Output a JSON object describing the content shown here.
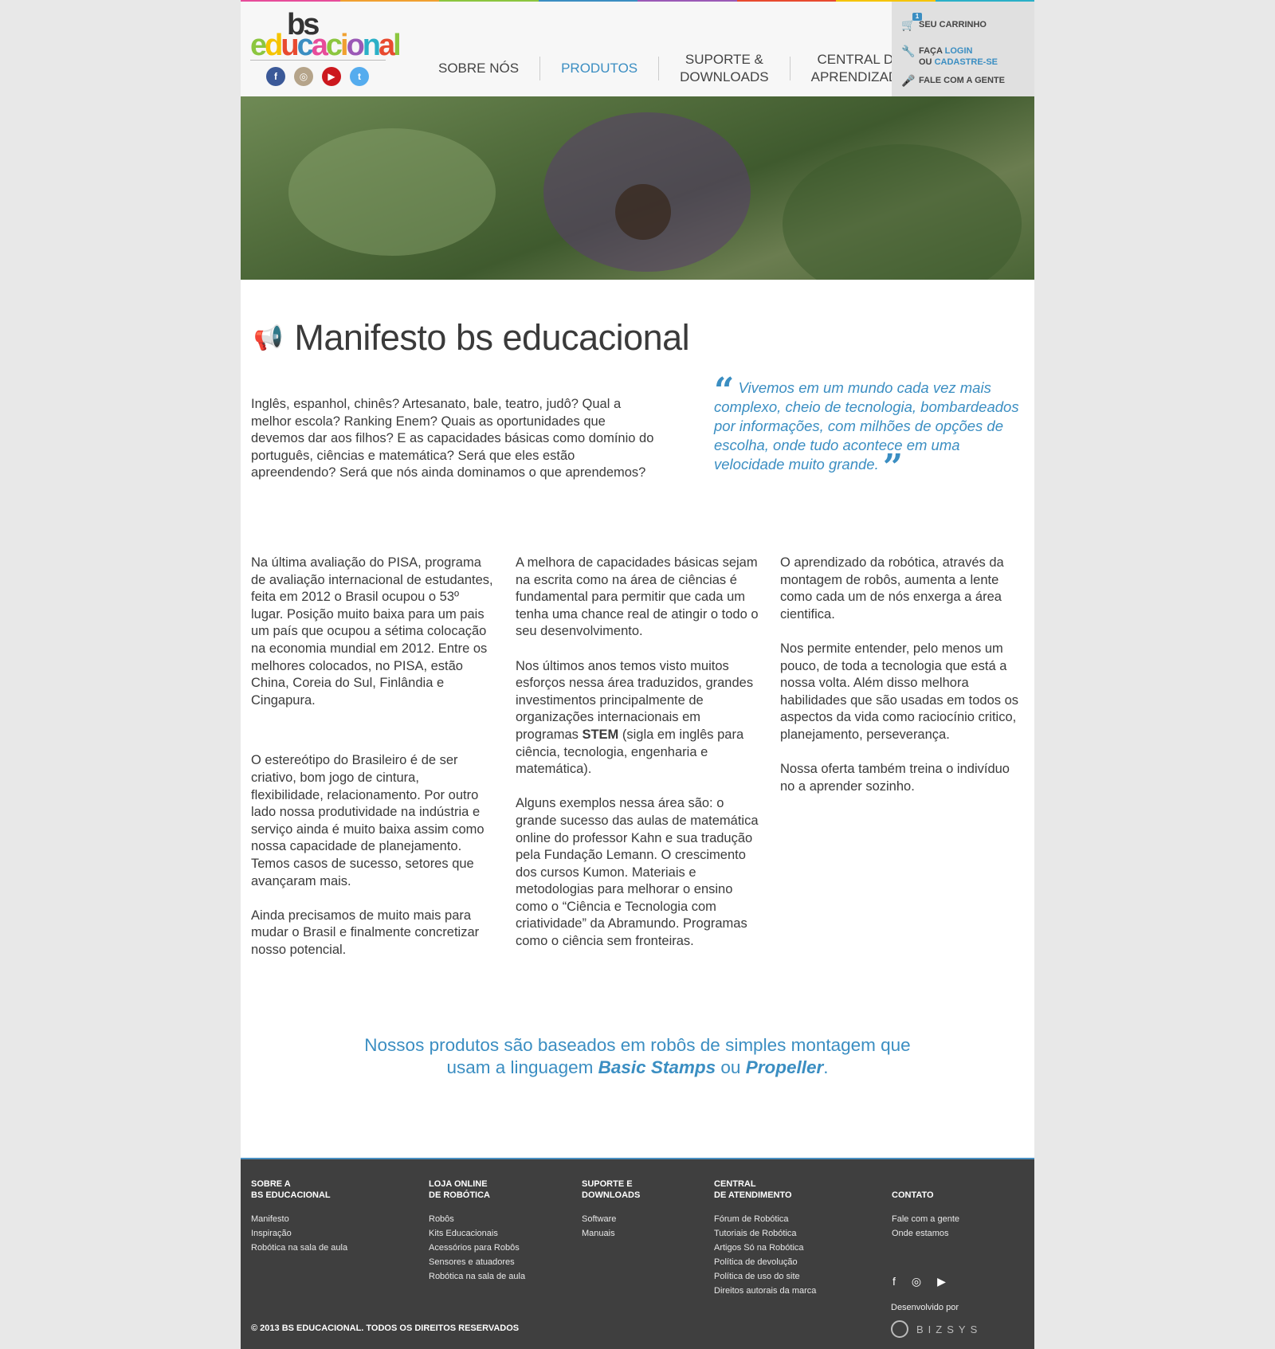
{
  "stripe_colors": [
    "#e74c9a",
    "#f0a030",
    "#8cc63f",
    "#3b8ec2",
    "#9b59b6",
    "#e84a2f",
    "#f5c400",
    "#2bb0c7"
  ],
  "logo": {
    "top": "bs",
    "bottom": "educacional"
  },
  "social": [
    {
      "name": "facebook",
      "glyph": "f",
      "color": "#3b5998"
    },
    {
      "name": "instagram",
      "glyph": "◎",
      "color": "#b5a48a"
    },
    {
      "name": "youtube",
      "glyph": "▶",
      "color": "#cc181e"
    },
    {
      "name": "twitter",
      "glyph": "t",
      "color": "#55acee"
    }
  ],
  "nav": {
    "about": "SOBRE NÓS",
    "products": "PRODUTOS",
    "support_1": "SUPORTE &",
    "support_2": "DOWNLOADS",
    "learning_1": "CENTRAL DE",
    "learning_2": "APRENDIZADO"
  },
  "user_box": {
    "cart": "SEU CARRINHO",
    "cart_badge": "1",
    "login_prefix": "FAÇA",
    "login": "LOGIN",
    "or": "OU",
    "signup": "CADASTRE-SE",
    "contact": "FALE COM A GENTE"
  },
  "main": {
    "title": "Manifesto bs educacional",
    "intro": "Inglês, espanhol, chinês? Artesanato, bale, teatro, judô? Qual a melhor escola? Ranking Enem? Quais as oportunidades que devemos dar aos filhos? E as capacidades básicas como domínio do português, ciências e matemática? Será que eles estão apreendendo? Será que nós ainda dominamos o que aprendemos?",
    "quote": "Vivemos em um mundo cada vez mais complexo, cheio de tecnologia, bombardeados por informações, com milhões de opções de escolha, onde tudo acontece em uma velocidade muito grande.",
    "col1": [
      "Na última avaliação do PISA, programa de avaliação internacional de estudantes, feita em 2012 o Brasil ocupou o 53º lugar. Posição muito baixa para um pais um país que ocupou a sétima colocação na economia mundial em 2012. Entre os melhores colocados, no PISA, estão China, Coreia do Sul, Finlândia e Cingapura.",
      "O estereótipo do Brasileiro é de ser criativo, bom jogo de cintura, flexibilidade, relacionamento. Por outro lado nossa produtividade na indústria e serviço ainda é muito baixa assim como nossa capacidade de planejamento. Temos casos de sucesso, setores que avançaram mais.",
      "Ainda precisamos de muito mais para mudar o Brasil e finalmente concretizar nosso potencial."
    ],
    "col2": {
      "p1": "A melhora de capacidades básicas sejam na escrita como na área de ciências é fundamental para permitir que cada um tenha uma chance real de atingir o todo o seu desenvolvimento.",
      "p2_before": "Nos últimos anos temos visto muitos esforços nessa área traduzidos, grandes investimentos principalmente de organizações internacionais em programas ",
      "p2_bold": "STEM",
      "p2_after": " (sigla em inglês para ciência, tecnologia, engenharia e matemática).",
      "p3": "Alguns exemplos nessa área são: o grande sucesso das aulas de matemática online do professor Kahn e sua tradução pela Fundação Lemann. O crescimento dos cursos Kumon. Materiais e metodologias para melhorar o ensino como o “Ciência e Tecnologia com criatividade” da Abramundo. Programas como o ciência sem fronteiras."
    },
    "col3": [
      "O aprendizado da robótica, através da montagem de robôs, aumenta a lente como cada um de nós enxerga a área cientifica.",
      "Nos permite entender, pelo menos um pouco, de toda a tecnologia que está a nossa volta. Além disso melhora habilidades que são usadas em todos os aspectos da vida como raciocínio critico, planejamento, perseverança.",
      "Nossa oferta também treina o indivíduo no a aprender sozinho."
    ],
    "products": {
      "line1": "Nossos produtos são baseados em robôs de simples montagem que",
      "line2_before": "usam a linguagem ",
      "basic": "Basic Stamps",
      "or": " ou ",
      "propeller": "Propeller",
      "end": "."
    }
  },
  "footer": {
    "col1": {
      "h1": "SOBRE A",
      "h2": "BS EDUCACIONAL",
      "items": [
        "Manifesto",
        "Inspiração",
        "Robótica na sala de aula"
      ]
    },
    "col2": {
      "h1": "LOJA ONLINE",
      "h2": "DE ROBÓTICA",
      "items": [
        "Robôs",
        "Kits Educacionais",
        "Acessórios para Robôs",
        "Sensores e atuadores",
        "Robótica na sala de aula"
      ]
    },
    "col3": {
      "h1": "SUPORTE E",
      "h2": "DOWNLOADS",
      "items": [
        "Software",
        "Manuais"
      ]
    },
    "col4": {
      "h1": "CENTRAL",
      "h2": "DE ATENDIMENTO",
      "items": [
        "Fórum de Robótica",
        "Tutoriais de Robótica",
        "Artigos Só na Robótica",
        "Política de devolução",
        "Política de uso do site",
        "Direitos autorais da marca"
      ]
    },
    "col5": {
      "h1": "",
      "h2": "CONTATO",
      "items": [
        "Fale com a gente",
        "Onde estamos"
      ]
    },
    "developed_by": "Desenvolvido por",
    "dev_brand": "BIZSYS",
    "copyright": "© 2013 BS EDUCACIONAL. TODOS OS DIREITOS RESERVADOS"
  }
}
